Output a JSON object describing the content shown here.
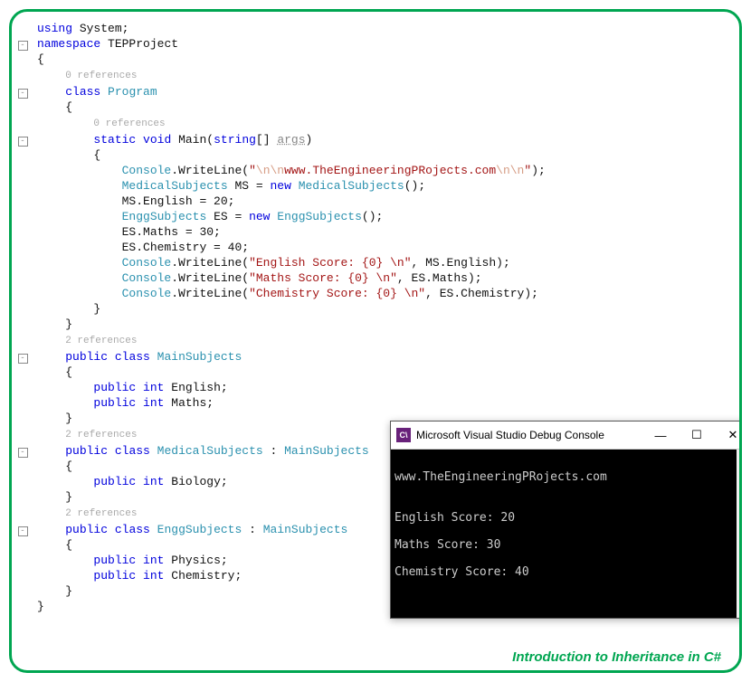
{
  "code": {
    "using": "using",
    "system": "System",
    "namespace": "namespace",
    "ns_name": "TEPProject",
    "refs0": "0 references",
    "refs2": "2 references",
    "class_kw": "class",
    "program": "Program",
    "static": "static",
    "void": "void",
    "main": "Main",
    "string_arr": "string",
    "args": "args",
    "console": "Console",
    "writeline": "WriteLine",
    "str1a": "\"",
    "str1_esc1": "\\n\\n",
    "str1_mid": "www.TheEngineeringPRojects.com",
    "str1_esc2": "\\n\\n",
    "str1b": "\"",
    "medsubj_type": "MedicalSubjects",
    "ms": "MS",
    "new": "new",
    "ms_english": "MS.English = 20;",
    "enggsubj_type": "EnggSubjects",
    "es": "ES",
    "es_maths": "ES.Maths = 30;",
    "es_chem": "ES.Chemistry = 40;",
    "str2": "\"English Score: {0} \\n\"",
    "arg2": "MS.English",
    "str3": "\"Maths Score: {0} \\n\"",
    "arg3": "ES.Maths",
    "str4": "\"Chemistry Score: {0} \\n\"",
    "arg4": "ES.Chemistry",
    "public": "public",
    "int": "int",
    "mainsubj": "MainSubjects",
    "english_f": "English",
    "maths_f": "Maths",
    "biology_f": "Biology",
    "physics_f": "Physics",
    "chem_f": "Chemistry"
  },
  "console": {
    "title": "Microsoft Visual Studio Debug Console",
    "icon": "C\\",
    "output": {
      "l1": "www.TheEngineeringPRojects.com",
      "l2": "English Score: 20",
      "l3": "Maths Score: 30",
      "l4": "Chemistry Score: 40"
    },
    "btn_min": "—",
    "btn_max": "☐",
    "btn_close": "✕"
  },
  "footer": "Introduction to Inheritance in C#"
}
